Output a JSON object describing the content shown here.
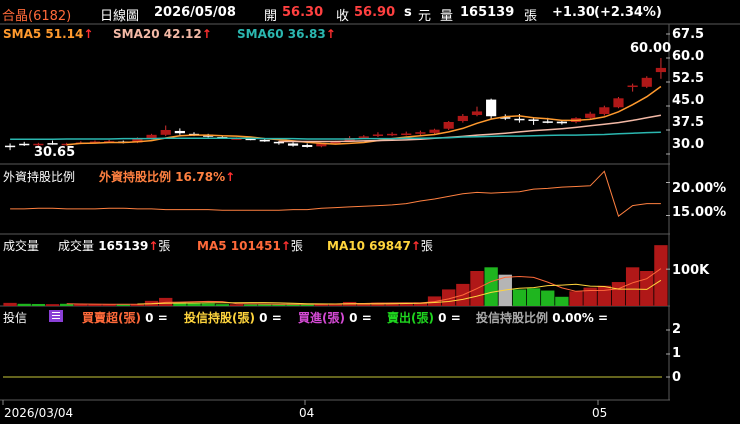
{
  "header": {
    "stock_name": "合晶(6182)",
    "period": "日線圖",
    "date": "2026/05/08",
    "open_label": "開",
    "open": "56.30",
    "close_label": "收",
    "close": "56.90",
    "s_label": "s",
    "unit": "元",
    "volume_label": "量",
    "volume": "165139",
    "volume_unit": "張",
    "change": "+1.30",
    "change_pct": "(+2.34%)"
  },
  "legends": {
    "sma5": "SMA5 51.14",
    "sma20": "SMA20 42.12",
    "sma60": "SMA60 36.83",
    "up_arrow": "↑",
    "foreign_title": "外資持股比例",
    "foreign_item": "外資持股比例 16.78%",
    "volume_title": "成交量",
    "volume_item_label": "成交量",
    "volume_item_value": "165139",
    "volume_item_unit": "張",
    "ma5": "MA5 101451",
    "ma10": "MA10 69847",
    "trust_title": "投信",
    "trust_buysell": "買賣超(張)",
    "trust_buysell_val": "0 =",
    "trust_hold": "投信持股(張)",
    "trust_hold_val": "0 =",
    "trust_buy": "買進(張)",
    "trust_buy_val": "0 =",
    "trust_sell": "賣出(張)",
    "trust_sell_val": "0 =",
    "trust_pct": "投信持股比例",
    "trust_pct_val": "0.00% ="
  },
  "y_axis": {
    "price_ticks": [
      "67.5",
      "60.0",
      "52.5",
      "45.0",
      "37.5",
      "30.0"
    ],
    "foreign_ticks": [
      "20.00%",
      "15.00%"
    ],
    "volume_ticks": [
      "100K"
    ],
    "trust_ticks": [
      "2",
      "1",
      "0"
    ]
  },
  "annotations": {
    "high": "60.00",
    "low": "30.65"
  },
  "x_axis": {
    "labels": [
      "2026/03/04",
      "04",
      "05"
    ]
  },
  "colors": {
    "up": "#b01818",
    "down": "#1fb51f",
    "flat": "#ffffff",
    "sma5": "#ff9a2e",
    "sma20": "#f3b9a6",
    "sma60": "#2bb7b0",
    "foreign": "#ff8040",
    "ma5": "#ff6a3a",
    "ma10": "#ffd53d",
    "trust_line": "#c8c83a",
    "grid": "#5a5a5a"
  },
  "chart_data": [
    {
      "type": "candlestick",
      "title": "合晶(6182) 日線圖",
      "ylim": [
        27.5,
        70
      ],
      "candles": [
        {
          "o": 32.6,
          "h": 33.3,
          "l": 31.2,
          "c": 32.4
        },
        {
          "o": 33.2,
          "h": 33.8,
          "l": 32.5,
          "c": 33.0
        },
        {
          "o": 32.8,
          "h": 33.5,
          "l": 32.3,
          "c": 33.2
        },
        {
          "o": 33.4,
          "h": 34.2,
          "l": 32.9,
          "c": 33.4
        },
        {
          "o": 33.0,
          "h": 33.5,
          "l": 32.6,
          "c": 33.2
        },
        {
          "o": 33.4,
          "h": 34.0,
          "l": 33.1,
          "c": 33.6
        },
        {
          "o": 33.6,
          "h": 34.2,
          "l": 33.3,
          "c": 33.9
        },
        {
          "o": 33.9,
          "h": 34.4,
          "l": 33.5,
          "c": 34.0
        },
        {
          "o": 33.9,
          "h": 34.2,
          "l": 33.3,
          "c": 33.5
        },
        {
          "o": 33.6,
          "h": 35.2,
          "l": 33.4,
          "c": 34.8
        },
        {
          "o": 34.9,
          "h": 36.3,
          "l": 34.5,
          "c": 36.0
        },
        {
          "o": 36.0,
          "h": 38.9,
          "l": 35.6,
          "c": 37.5
        },
        {
          "o": 37.2,
          "h": 38.0,
          "l": 36.0,
          "c": 36.5
        },
        {
          "o": 36.3,
          "h": 36.8,
          "l": 35.6,
          "c": 36.0
        },
        {
          "o": 36.0,
          "h": 36.3,
          "l": 35.2,
          "c": 35.4
        },
        {
          "o": 35.3,
          "h": 35.6,
          "l": 34.7,
          "c": 34.8
        },
        {
          "o": 34.8,
          "h": 35.2,
          "l": 34.5,
          "c": 34.9
        },
        {
          "o": 34.8,
          "h": 35.1,
          "l": 34.3,
          "c": 34.4
        },
        {
          "o": 34.4,
          "h": 34.7,
          "l": 33.8,
          "c": 34.0
        },
        {
          "o": 33.8,
          "h": 34.1,
          "l": 32.9,
          "c": 33.4
        },
        {
          "o": 33.3,
          "h": 33.7,
          "l": 32.3,
          "c": 32.6
        },
        {
          "o": 32.8,
          "h": 33.3,
          "l": 32.0,
          "c": 32.2
        },
        {
          "o": 32.4,
          "h": 33.5,
          "l": 32.1,
          "c": 33.3
        },
        {
          "o": 33.3,
          "h": 34.1,
          "l": 33.0,
          "c": 33.9
        },
        {
          "o": 34.0,
          "h": 35.6,
          "l": 33.8,
          "c": 35.0
        },
        {
          "o": 35.3,
          "h": 35.9,
          "l": 34.8,
          "c": 35.5
        },
        {
          "o": 35.7,
          "h": 36.8,
          "l": 35.3,
          "c": 36.1
        },
        {
          "o": 36.0,
          "h": 36.8,
          "l": 35.6,
          "c": 36.3
        },
        {
          "o": 36.3,
          "h": 37.0,
          "l": 35.8,
          "c": 36.4
        },
        {
          "o": 36.4,
          "h": 37.3,
          "l": 35.9,
          "c": 36.8
        },
        {
          "o": 36.6,
          "h": 37.9,
          "l": 36.2,
          "c": 37.6
        },
        {
          "o": 37.9,
          "h": 40.3,
          "l": 37.5,
          "c": 40.0
        },
        {
          "o": 40.3,
          "h": 42.5,
          "l": 39.8,
          "c": 41.9
        },
        {
          "o": 42.2,
          "h": 44.8,
          "l": 41.8,
          "c": 43.3
        },
        {
          "o": 47.0,
          "h": 47.3,
          "l": 40.8,
          "c": 41.8
        },
        {
          "o": 41.5,
          "h": 42.4,
          "l": 40.6,
          "c": 41.3
        },
        {
          "o": 41.0,
          "h": 42.5,
          "l": 39.8,
          "c": 41.0
        },
        {
          "o": 40.8,
          "h": 41.5,
          "l": 39.1,
          "c": 40.5
        },
        {
          "o": 40.2,
          "h": 41.3,
          "l": 39.6,
          "c": 40.2
        },
        {
          "o": 40.1,
          "h": 40.5,
          "l": 39.2,
          "c": 39.6
        },
        {
          "o": 40.0,
          "h": 41.5,
          "l": 39.6,
          "c": 41.2
        },
        {
          "o": 41.3,
          "h": 43.2,
          "l": 41.0,
          "c": 42.6
        },
        {
          "o": 42.5,
          "h": 45.1,
          "l": 42.0,
          "c": 44.6
        },
        {
          "o": 44.6,
          "h": 47.8,
          "l": 44.3,
          "c": 47.4
        },
        {
          "o": 51.2,
          "h": 52.0,
          "l": 49.5,
          "c": 51.4
        },
        {
          "o": 51.0,
          "h": 54.3,
          "l": 50.6,
          "c": 53.8
        },
        {
          "o": 55.6,
          "h": 60.0,
          "l": 53.5,
          "c": 56.9
        }
      ]
    },
    {
      "type": "line",
      "series": [
        {
          "name": "SMA5",
          "values": [
            null,
            null,
            null,
            null,
            32.9,
            33.3,
            33.4,
            33.6,
            33.6,
            33.8,
            34.2,
            35.0,
            35.7,
            35.9,
            35.9,
            35.7,
            35.6,
            35.3,
            34.8,
            34.5,
            34.1,
            33.7,
            33.3,
            33.1,
            33.3,
            33.6,
            34.2,
            34.8,
            35.3,
            35.7,
            36.1,
            36.9,
            38.0,
            39.6,
            40.9,
            41.7,
            41.9,
            41.3,
            41.0,
            40.5,
            40.5,
            40.8,
            41.6,
            43.2,
            45.4,
            47.9,
            51.1
          ]
        },
        {
          "name": "SMA20",
          "values": [
            null,
            null,
            null,
            null,
            null,
            null,
            null,
            null,
            null,
            null,
            null,
            null,
            null,
            null,
            null,
            null,
            null,
            null,
            null,
            33.9,
            33.9,
            33.9,
            33.9,
            33.9,
            34.0,
            34.1,
            34.2,
            34.3,
            34.4,
            34.6,
            34.9,
            35.2,
            35.5,
            35.9,
            36.2,
            36.5,
            36.9,
            37.3,
            37.6,
            37.9,
            38.3,
            38.8,
            39.3,
            39.8,
            40.5,
            41.3,
            42.1
          ]
        },
        {
          "name": "SMA60",
          "values": [
            34.6,
            34.6,
            34.6,
            34.6,
            34.7,
            34.7,
            34.7,
            34.7,
            34.8,
            34.8,
            34.8,
            34.9,
            34.9,
            34.9,
            34.9,
            34.9,
            34.9,
            34.9,
            34.8,
            34.8,
            34.8,
            34.7,
            34.7,
            34.7,
            34.7,
            34.8,
            34.8,
            34.8,
            34.9,
            34.9,
            35.0,
            35.1,
            35.3,
            35.4,
            35.5,
            35.6,
            35.6,
            35.7,
            35.8,
            35.9,
            35.9,
            36.0,
            36.1,
            36.3,
            36.5,
            36.7,
            36.8
          ]
        }
      ]
    },
    {
      "type": "line",
      "series": [
        {
          "name": "外資持股比例",
          "values": [
            16.0,
            16.0,
            16.1,
            16.1,
            16.0,
            16.0,
            16.0,
            16.1,
            16.1,
            16.0,
            16.0,
            15.9,
            15.9,
            15.9,
            15.9,
            15.8,
            15.8,
            15.8,
            15.8,
            15.8,
            15.9,
            15.9,
            16.1,
            16.2,
            16.3,
            16.4,
            16.5,
            16.6,
            16.8,
            17.2,
            17.5,
            17.9,
            18.3,
            18.5,
            18.4,
            18.5,
            18.6,
            19.0,
            19.1,
            19.3,
            19.4,
            19.5,
            21.7,
            14.9,
            16.5,
            16.8,
            16.8
          ]
        }
      ],
      "ylim": [
        12.5,
        22.5
      ]
    },
    {
      "type": "bar",
      "ylim": [
        0,
        190000
      ],
      "values": [
        8500,
        6000,
        5500,
        5000,
        6000,
        5000,
        4500,
        4000,
        5500,
        4000,
        14000,
        22000,
        9000,
        8000,
        7000,
        5000,
        4500,
        4000,
        5000,
        4500,
        6000,
        4500,
        5000,
        7000,
        11000,
        7000,
        9000,
        7000,
        8000,
        10000,
        26000,
        45000,
        60000,
        95000,
        105000,
        85000,
        45000,
        48000,
        42000,
        25000,
        40000,
        50000,
        55000,
        65000,
        105000,
        95000,
        165139
      ],
      "directions": [
        "up",
        "down",
        "down",
        "up",
        "down",
        "up",
        "up",
        "up",
        "down",
        "up",
        "up",
        "up",
        "down",
        "down",
        "down",
        "down",
        "up",
        "down",
        "down",
        "down",
        "down",
        "down",
        "up",
        "up",
        "up",
        "up",
        "up",
        "up",
        "up",
        "up",
        "up",
        "up",
        "up",
        "up",
        "down",
        "flat",
        "down",
        "down",
        "down",
        "down",
        "up",
        "up",
        "up",
        "up",
        "up",
        "up",
        "up"
      ],
      "series": [
        {
          "name": "MA5",
          "values": [
            null,
            null,
            null,
            null,
            6200,
            5500,
            5200,
            4900,
            5000,
            4600,
            6400,
            9900,
            10700,
            11400,
            12400,
            12000,
            6500,
            5700,
            5300,
            4600,
            4800,
            4600,
            5000,
            5400,
            6700,
            6900,
            7800,
            8200,
            8400,
            8200,
            12000,
            19200,
            29800,
            47200,
            66200,
            78000,
            80000,
            77600,
            65000,
            49000,
            40000,
            42000,
            42400,
            47000,
            63000,
            74000,
            101451
          ]
        },
        {
          "name": "MA10",
          "values": [
            null,
            null,
            null,
            null,
            null,
            null,
            null,
            null,
            null,
            5400,
            5900,
            7500,
            7900,
            8200,
            8700,
            8700,
            8700,
            9100,
            9100,
            8500,
            7700,
            6200,
            5800,
            5500,
            5600,
            5800,
            5800,
            6100,
            6700,
            7400,
            9400,
            12200,
            17900,
            26800,
            37000,
            43400,
            48000,
            50000,
            55300,
            56800,
            59000,
            54000,
            53000,
            46000,
            46000,
            45000,
            69847
          ]
        }
      ]
    }
  ]
}
